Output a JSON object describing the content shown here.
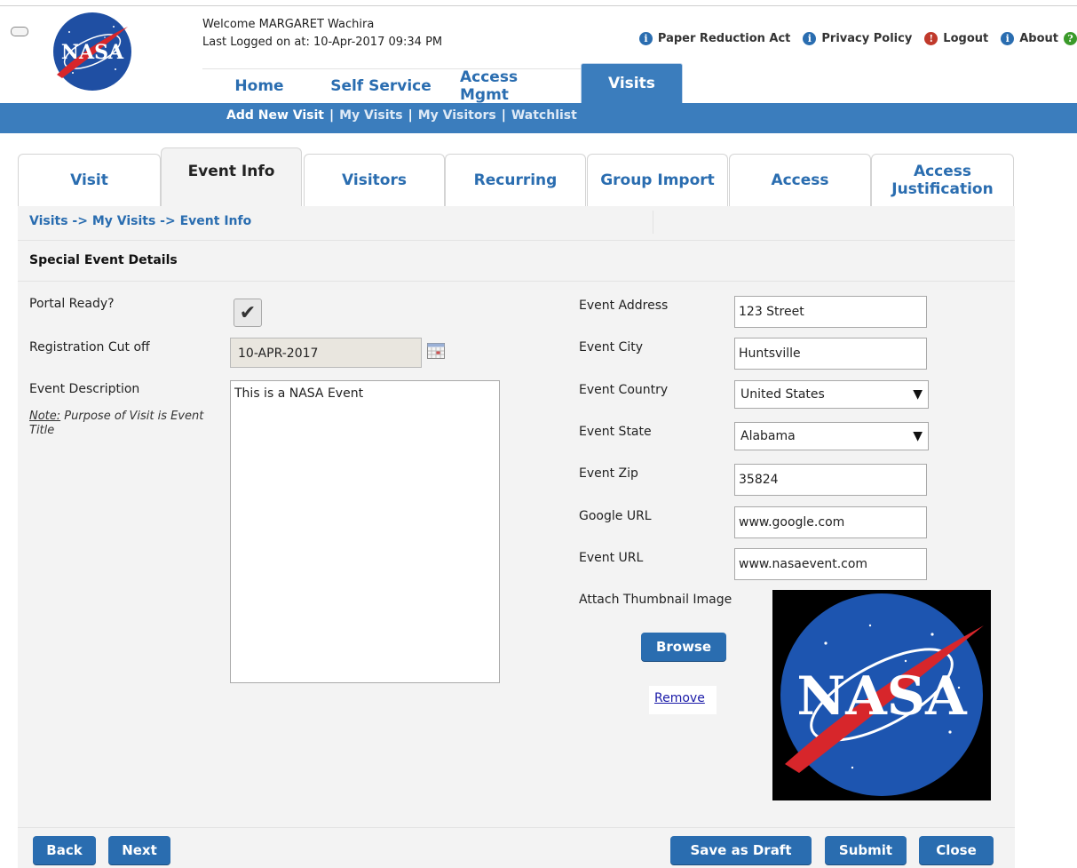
{
  "header": {
    "welcome": "Welcome MARGARET Wachira",
    "last_logged": "Last Logged on at: 10-Apr-2017 09:34 PM",
    "logo_text": "NASA",
    "links": [
      {
        "label": "Paper Reduction Act",
        "icon": "info-icon"
      },
      {
        "label": "Privacy Policy",
        "icon": "info-icon"
      },
      {
        "label": "Logout",
        "icon": "alert-icon"
      },
      {
        "label": "About",
        "icon": "info-icon"
      }
    ]
  },
  "main_tabs": [
    {
      "label": "Home",
      "active": false
    },
    {
      "label": "Self Service",
      "active": false
    },
    {
      "label": "Access Mgmt",
      "active": false
    },
    {
      "label": "Visits",
      "active": true
    }
  ],
  "subnav": {
    "add_new_visit": "Add New Visit",
    "my_visits": "My Visits",
    "my_visitors": "My Visitors",
    "watchlist": "Watchlist",
    "separator": "|"
  },
  "visit_tabs": [
    {
      "label": "Visit",
      "active": false
    },
    {
      "label": "Event Info",
      "active": true
    },
    {
      "label": "Visitors",
      "active": false
    },
    {
      "label": "Recurring",
      "active": false
    },
    {
      "label": "Group Import",
      "active": false
    },
    {
      "label": "Access",
      "active": false
    },
    {
      "label": "Access\nJustification",
      "active": false
    }
  ],
  "breadcrumb": "Visits -> My Visits -> Event Info",
  "section_title": "Special Event Details",
  "left_form": {
    "portal_ready_label": "Portal Ready?",
    "portal_ready_checked": true,
    "checkmark": "✔",
    "registration_cutoff_label": "Registration Cut off",
    "registration_cutoff_value": "10-APR-2017",
    "event_description_label": "Event Description",
    "note_prefix": "Note:",
    "note_text": " Purpose of Visit is Event Title",
    "event_description_value": "This is a NASA Event"
  },
  "right_form": {
    "event_address_label": "Event Address",
    "event_address_value": "123 Street",
    "event_city_label": "Event City",
    "event_city_value": "Huntsville",
    "event_country_label": "Event Country",
    "event_country_value": "United States",
    "event_state_label": "Event State",
    "event_state_value": "Alabama",
    "event_zip_label": "Event Zip",
    "event_zip_value": "35824",
    "google_url_label": "Google URL",
    "google_url_value": "www.google.com",
    "event_url_label": "Event URL",
    "event_url_value": "www.nasaevent.com",
    "attach_label": "Attach Thumbnail Image",
    "browse_label": "Browse",
    "remove_label": "Remove",
    "dropdown_arrow": "▼"
  },
  "footer": {
    "back": "Back",
    "next": "Next",
    "save_draft": "Save as Draft",
    "submit": "Submit",
    "close": "Close"
  },
  "colors": {
    "accent": "#3b7dbd",
    "link": "#2a6db0",
    "panel": "#f3f3f3"
  }
}
